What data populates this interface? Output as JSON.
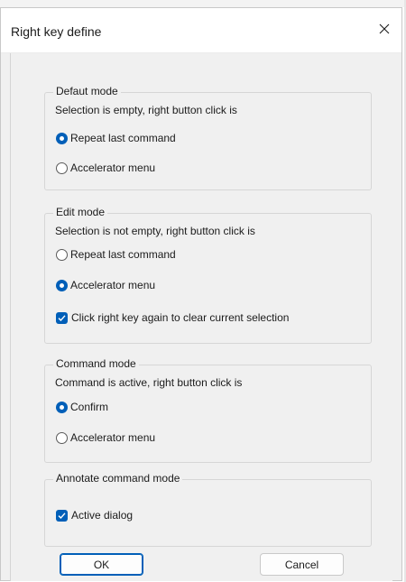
{
  "dialog": {
    "title": "Right key define",
    "close_glyph": "✕",
    "accent_color": "#005fb8"
  },
  "groups": {
    "default_mode": {
      "title": "Defaut mode",
      "description": "Selection is empty, right button click is",
      "options": [
        {
          "label": "Repeat last command",
          "checked": true
        },
        {
          "label": "Accelerator menu",
          "checked": false
        }
      ]
    },
    "edit_mode": {
      "title": "Edit mode",
      "description": "Selection is not empty, right button click is",
      "options": [
        {
          "label": "Repeat last command",
          "checked": false
        },
        {
          "label": "Accelerator menu",
          "checked": true
        }
      ],
      "checkbox": {
        "label": "Click right key again to clear current selection",
        "checked": true
      }
    },
    "command_mode": {
      "title": "Command mode",
      "description": "Command is active, right button click is",
      "options": [
        {
          "label": "Confirm",
          "checked": true
        },
        {
          "label": "Accelerator menu",
          "checked": false
        }
      ]
    },
    "annotate_mode": {
      "title": "Annotate command mode",
      "checkbox": {
        "label": "Active dialog",
        "checked": true
      }
    }
  },
  "buttons": {
    "ok_label": "OK",
    "cancel_label": "Cancel"
  },
  "icons": {
    "close": "close-icon",
    "check": "checkmark-icon"
  }
}
